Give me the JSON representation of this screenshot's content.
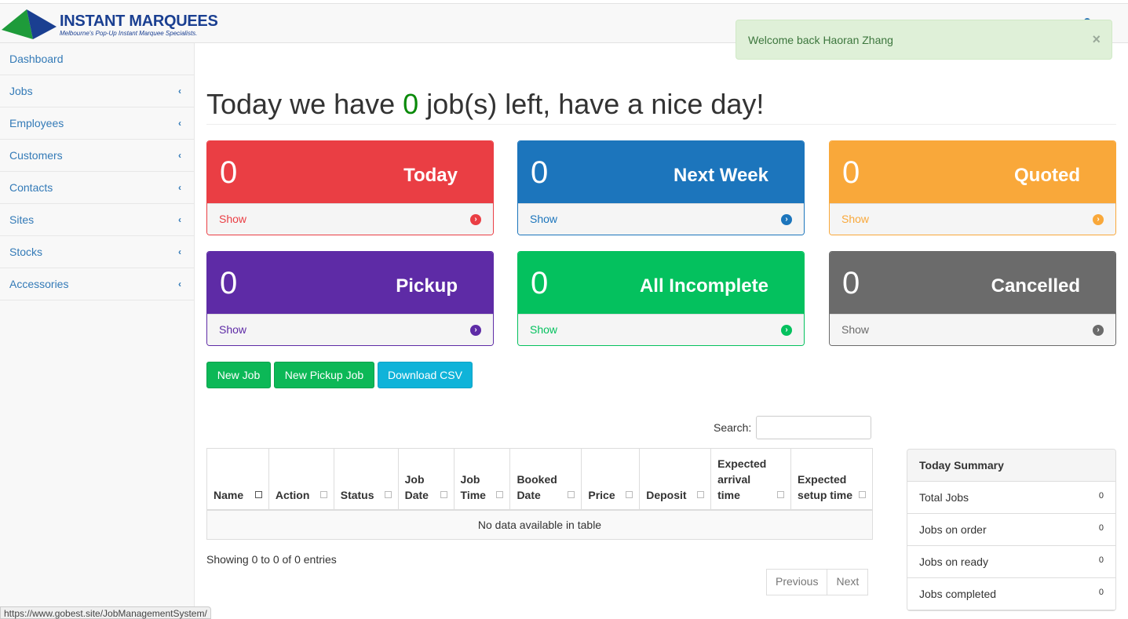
{
  "brand": {
    "title": "INSTANT MARQUEES",
    "subtitle": "Melbourne's Pop-Up Instant Marquee Specialists."
  },
  "alert": {
    "message": "Welcome back Haoran Zhang",
    "close": "×"
  },
  "sidebar": {
    "items": [
      {
        "label": "Dashboard",
        "chevron": ""
      },
      {
        "label": "Jobs",
        "chevron": "‹"
      },
      {
        "label": "Employees",
        "chevron": "‹"
      },
      {
        "label": "Customers",
        "chevron": "‹"
      },
      {
        "label": "Contacts",
        "chevron": "‹"
      },
      {
        "label": "Sites",
        "chevron": "‹"
      },
      {
        "label": "Stocks",
        "chevron": "‹"
      },
      {
        "label": "Accessories",
        "chevron": "‹"
      }
    ]
  },
  "heading": {
    "prefix": "Today we have ",
    "count": "0",
    "suffix": " job(s) left, have a nice day!"
  },
  "panels": [
    {
      "value": "0",
      "label": "Today",
      "link": "Show",
      "color": "#ea3e44"
    },
    {
      "value": "0",
      "label": "Next Week",
      "link": "Show",
      "color": "#1c75bc"
    },
    {
      "value": "0",
      "label": "Quoted",
      "link": "Show",
      "color": "#f9a83a"
    },
    {
      "value": "0",
      "label": "Pickup",
      "link": "Show",
      "color": "#5e2ba6"
    },
    {
      "value": "0",
      "label": "All Incomplete",
      "link": "Show",
      "color": "#04c15e"
    },
    {
      "value": "0",
      "label": "Cancelled",
      "link": "Show",
      "color": "#6b6b6b"
    }
  ],
  "buttons": {
    "new_job": "New Job",
    "new_pickup_job": "New Pickup Job",
    "download_csv": "Download CSV"
  },
  "search": {
    "label": "Search:",
    "value": ""
  },
  "table": {
    "columns": [
      "Name",
      "Action",
      "Status",
      "Job Date",
      "Job Time",
      "Booked Date",
      "Price",
      "Deposit",
      "Expected arrival time",
      "Expected setup time"
    ],
    "empty": "No data available in table",
    "info": "Showing 0 to 0 of 0 entries",
    "prev": "Previous",
    "next": "Next"
  },
  "summary": {
    "title": "Today Summary",
    "rows": [
      {
        "label": "Total Jobs",
        "value": "0"
      },
      {
        "label": "Jobs on order",
        "value": "0"
      },
      {
        "label": "Jobs on ready",
        "value": "0"
      },
      {
        "label": "Jobs completed",
        "value": "0"
      }
    ]
  },
  "statusbar": {
    "url": "https://www.gobest.site/JobManagementSystem/"
  }
}
